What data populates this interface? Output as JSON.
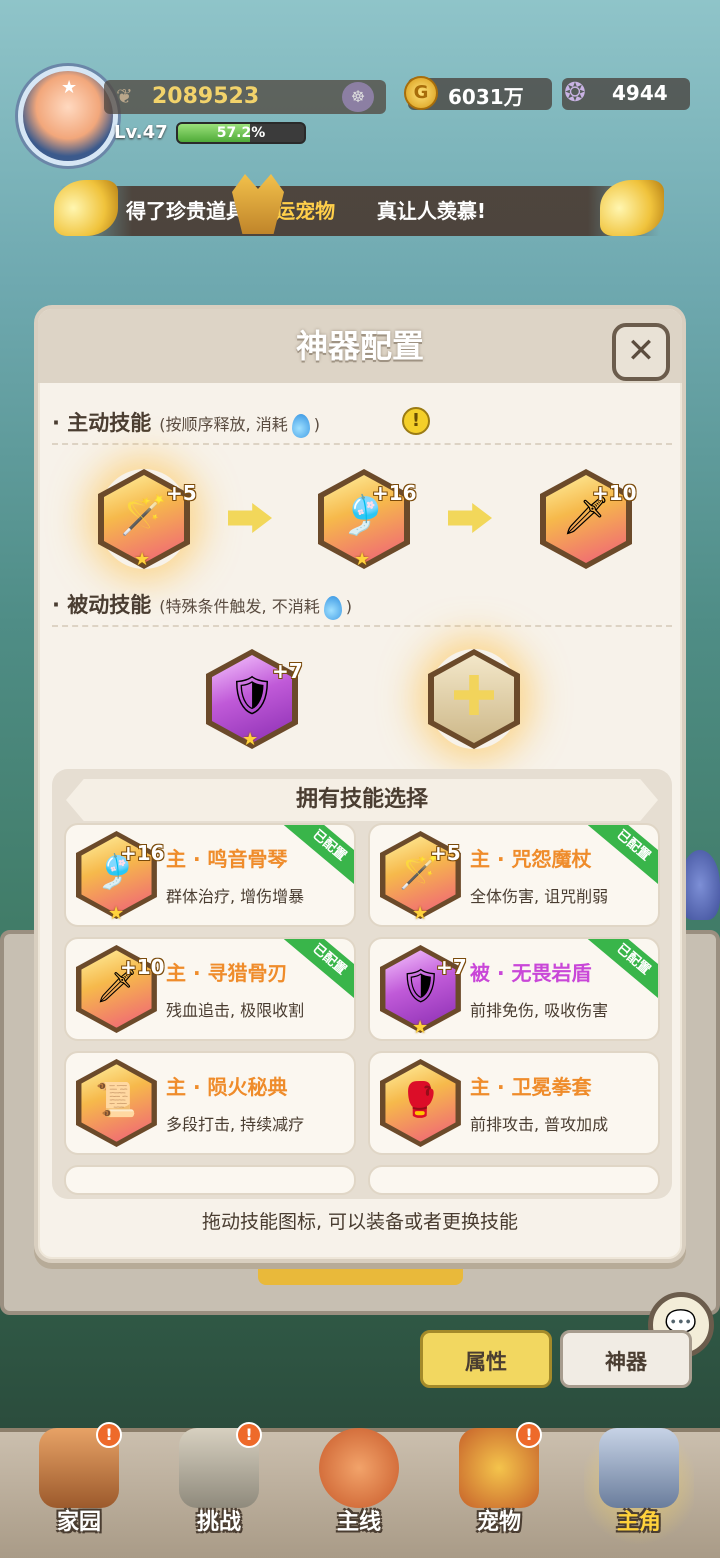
{
  "hud": {
    "exp_value": "2089523",
    "level": "Lv.47",
    "level_progress_text": "57.2%",
    "level_progress": 0.572,
    "gold": "6031万",
    "shells": "4944"
  },
  "banner": {
    "text_before": "得了珍贵道具",
    "highlight": "[幸运宠物",
    "text_after": "真让人羡慕!"
  },
  "dialog": {
    "title": "神器配置",
    "close_icon": "✕",
    "active_section": {
      "title": "主动技能",
      "subtitle_before": "(按顺序释放, 消耗",
      "subtitle_after": ")",
      "warn_icon": "!"
    },
    "active_skills": [
      {
        "level": "+5",
        "icon": "staff-icon"
      },
      {
        "level": "+16",
        "icon": "harp-icon"
      },
      {
        "level": "+10",
        "icon": "blade-icon"
      }
    ],
    "passive_section": {
      "title": "被动技能",
      "subtitle_before": "(特殊条件触发, 不消耗",
      "subtitle_after": ")"
    },
    "passive_skills": [
      {
        "level": "+7",
        "icon": "shield-icon"
      }
    ],
    "owned": {
      "title": "拥有技能选择",
      "items": [
        {
          "level": "+16",
          "name": "主 · 鸣音骨琴",
          "desc": "群体治疗, 增伤增暴",
          "tag": "已配置"
        },
        {
          "level": "+5",
          "name": "主 · 咒怨魔杖",
          "desc": "全体伤害, 诅咒削弱",
          "tag": "已配置"
        },
        {
          "level": "+10",
          "name": "主 · 寻猎骨刃",
          "desc": "残血追击, 极限收割",
          "tag": "已配置"
        },
        {
          "level": "+7",
          "name": "被 · 无畏岩盾",
          "desc": "前排免伤, 吸收伤害",
          "tag": "已配置"
        },
        {
          "level": "",
          "name": "主 · 陨火秘典",
          "desc": "多段打击, 持续减疗",
          "tag": ""
        },
        {
          "level": "",
          "name": "主 · 卫冕拳套",
          "desc": "前排攻击, 普攻加成",
          "tag": ""
        }
      ]
    },
    "hint": "拖动技能图标, 可以装备或者更换技能"
  },
  "tabs": {
    "attr": "属性",
    "artifact": "神器"
  },
  "nav": [
    {
      "label": "家园",
      "badge": "!"
    },
    {
      "label": "挑战",
      "badge": "!"
    },
    {
      "label": "主线",
      "badge": ""
    },
    {
      "label": "宠物",
      "badge": "!"
    },
    {
      "label": "主角",
      "badge": ""
    }
  ],
  "colors": {
    "active_orange": "#ef8c2b",
    "passive_purple": "#c947d8",
    "configured_green": "#39b54a",
    "tab_active": "#f2d760"
  }
}
